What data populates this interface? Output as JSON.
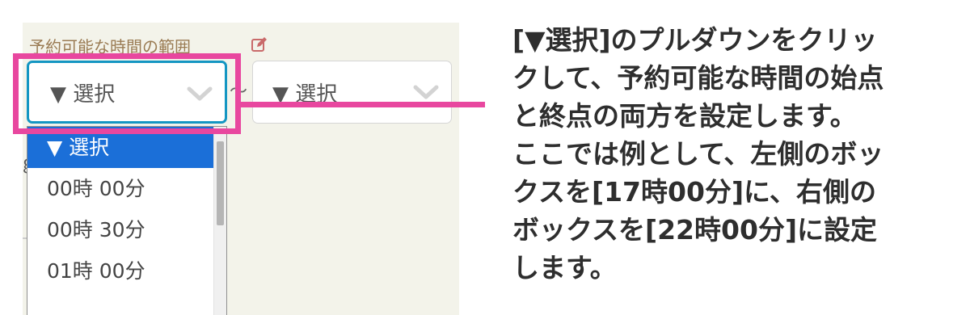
{
  "form": {
    "label": "予約可能な時間の範囲",
    "start_select": {
      "value": "▼ 選択"
    },
    "separator": "〜",
    "end_select": {
      "value": "▼ 選択"
    }
  },
  "dropdown": {
    "options": [
      "▼ 選択",
      "00時 00分",
      "00時 30分",
      "01時 00分"
    ],
    "selected_index": 0
  },
  "instruction_lines": [
    "[▼選択]のプルダウンをクリッ",
    "クして、予約可能な時間の始点",
    "と終点の両方を設定します。",
    "ここでは例として、左側のボッ",
    "クスを[17時00分]に、右側の",
    "ボックスを[22時00分]に設定",
    "します。"
  ],
  "colors": {
    "highlight": "#e8479f",
    "focus_border": "#1496c2",
    "selected_option": "#1b6fd8",
    "label_text": "#9a7b53",
    "panel_bg": "#f3f3ea"
  },
  "icons": [
    "edit-icon",
    "chevron-down-icon"
  ]
}
